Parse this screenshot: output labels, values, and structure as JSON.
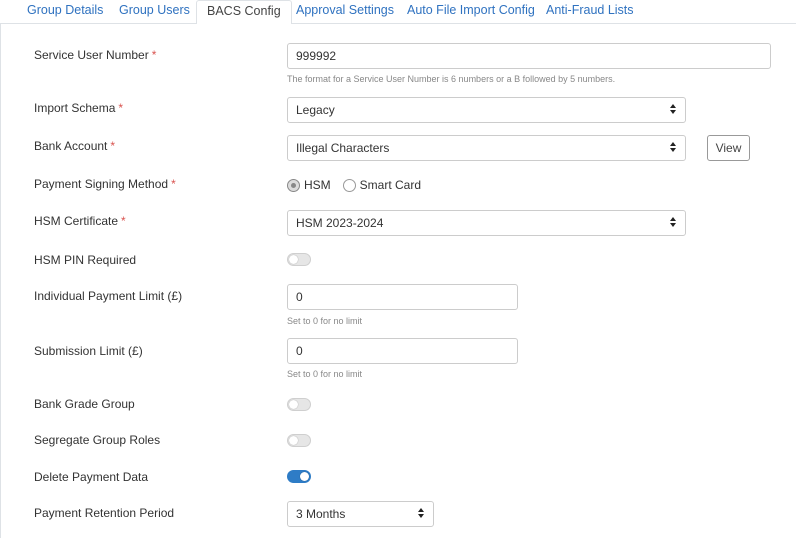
{
  "tabs": [
    {
      "label": "Group Details"
    },
    {
      "label": "Group Users"
    },
    {
      "label": "BACS Config"
    },
    {
      "label": "Approval Settings"
    },
    {
      "label": "Auto File Import Config"
    },
    {
      "label": "Anti-Fraud Lists"
    }
  ],
  "active_tab": "BACS Config",
  "form": {
    "service_user_number": {
      "label": "Service User Number",
      "required": "*",
      "value": "999992",
      "help": "The format for a Service User Number is 6 numbers or a B followed by 5 numbers."
    },
    "import_schema": {
      "label": "Import Schema",
      "required": "*",
      "value": "Legacy"
    },
    "bank_account": {
      "label": "Bank Account",
      "required": "*",
      "value": "Illegal Characters",
      "view_label": "View"
    },
    "payment_signing_method": {
      "label": "Payment Signing Method",
      "required": "*",
      "options": [
        {
          "label": "HSM",
          "checked": true
        },
        {
          "label": "Smart Card",
          "checked": false
        }
      ]
    },
    "hsm_certificate": {
      "label": "HSM Certificate",
      "required": "*",
      "value": "HSM 2023-2024"
    },
    "hsm_pin_required": {
      "label": "HSM PIN Required",
      "on": false
    },
    "individual_payment_limit": {
      "label": "Individual Payment Limit (£)",
      "value": "0",
      "help": "Set to 0 for no limit"
    },
    "submission_limit": {
      "label": "Submission Limit (£)",
      "value": "0",
      "help": "Set to 0 for no limit"
    },
    "bank_grade_group": {
      "label": "Bank Grade Group",
      "on": false
    },
    "segregate_group_roles": {
      "label": "Segregate Group Roles",
      "on": false
    },
    "delete_payment_data": {
      "label": "Delete Payment Data",
      "on": true
    },
    "payment_retention_period": {
      "label": "Payment Retention Period",
      "value": "3 Months"
    }
  },
  "colors": {
    "link": "#2f72c0",
    "required": "#d9534f",
    "toggle_on": "#2e7cc6"
  }
}
